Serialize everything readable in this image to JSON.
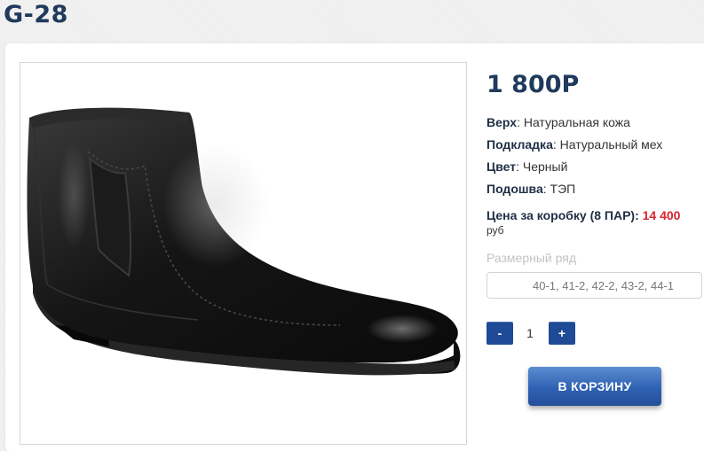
{
  "product": {
    "title": "G-28",
    "price": "1 800Р",
    "specs": [
      {
        "label": "Верх",
        "value": ": Натуральная кожа"
      },
      {
        "label": "Подкладка",
        "value": ": Натуральный мех"
      },
      {
        "label": "Цвет",
        "value": ": Черный"
      },
      {
        "label": "Подошва",
        "value": ": ТЭП"
      }
    ],
    "box_price_label": "Цена за коробку (8 ПАР): ",
    "box_price_value": "14 400",
    "currency": "руб",
    "size_label": "Размерный ряд",
    "size_value": "40-1, 41-2, 42-2, 43-2, 44-1",
    "image_icon": "black-leather-ankle-boot"
  },
  "quantity": {
    "minus_label": "-",
    "value": "1",
    "plus_label": "+"
  },
  "cart_button_label": "В КОРЗИНУ",
  "colors": {
    "title": "#1f3a5c",
    "accent_blue": "#1e4a96",
    "box_price_red": "#d8232a"
  }
}
